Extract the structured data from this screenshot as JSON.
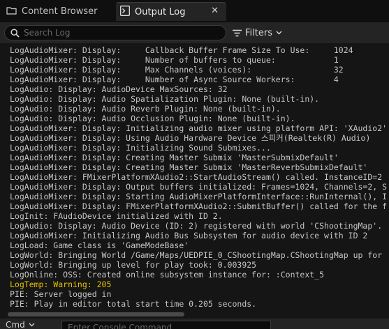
{
  "tabs": {
    "content_browser": {
      "label": "Content Browser",
      "icon": "folder-icon"
    },
    "output_log": {
      "label": "Output Log",
      "icon": "terminal-icon",
      "close_icon": "close-icon"
    }
  },
  "toolbar": {
    "search_placeholder": "Search Log",
    "filters_label": "Filters"
  },
  "log_lines": [
    {
      "text": "LogAudioMixer: Display:     Callback Buffer Frame Size To Use:     1024",
      "level": "info"
    },
    {
      "text": "LogAudioMixer: Display:     Number of buffers to queue:            1",
      "level": "info"
    },
    {
      "text": "LogAudioMixer: Display:     Max Channels (voices):                 32",
      "level": "info"
    },
    {
      "text": "LogAudioMixer: Display:     Number of Async Source Workers:        4",
      "level": "info"
    },
    {
      "text": "LogAudio: Display: AudioDevice MaxSources: 32",
      "level": "info"
    },
    {
      "text": "LogAudio: Display: Audio Spatialization Plugin: None (built-in).",
      "level": "info"
    },
    {
      "text": "LogAudio: Display: Audio Reverb Plugin: None (built-in).",
      "level": "info"
    },
    {
      "text": "LogAudio: Display: Audio Occlusion Plugin: None (built-in).",
      "level": "info"
    },
    {
      "text": "LogAudioMixer: Display: Initializing audio mixer using platform API: 'XAudio2'",
      "level": "info"
    },
    {
      "text": "LogAudioMixer: Display: Using Audio Hardware Device 스피커(Realtek(R) Audio)",
      "level": "info"
    },
    {
      "text": "LogAudioMixer: Display: Initializing Sound Submixes...",
      "level": "info"
    },
    {
      "text": "LogAudioMixer: Display: Creating Master Submix 'MasterSubmixDefault'",
      "level": "info"
    },
    {
      "text": "LogAudioMixer: Display: Creating Master Submix 'MasterReverbSubmixDefault'",
      "level": "info"
    },
    {
      "text": "LogAudioMixer: FMixerPlatformXAudio2::StartAudioStream() called. InstanceID=2",
      "level": "info"
    },
    {
      "text": "LogAudioMixer: Display: Output buffers initialized: Frames=1024, Channels=2, S",
      "level": "info"
    },
    {
      "text": "LogAudioMixer: Display: Starting AudioMixerPlatformInterface::RunInternal(), I",
      "level": "info"
    },
    {
      "text": "LogAudioMixer: Display: FMixerPlatformXAudio2::SubmitBuffer() called for the f",
      "level": "info"
    },
    {
      "text": "LogInit: FAudioDevice initialized with ID 2.",
      "level": "info"
    },
    {
      "text": "LogAudio: Display: Audio Device (ID: 2) registered with world 'CShootingMap'.",
      "level": "info"
    },
    {
      "text": "LogAudioMixer: Initializing Audio Bus Subsystem for audio device with ID 2",
      "level": "info"
    },
    {
      "text": "LogLoad: Game class is 'GameModeBase'",
      "level": "info"
    },
    {
      "text": "LogWorld: Bringing World /Game/Maps/UEDPIE_0_CShootingMap.CShootingMap up for",
      "level": "info"
    },
    {
      "text": "LogWorld: Bringing up level for play took: 0.003925",
      "level": "info"
    },
    {
      "text": "LogOnline: OSS: Created online subsystem instance for: :Context_5",
      "level": "info"
    },
    {
      "text": "LogTemp: Warning: 205",
      "level": "warning"
    },
    {
      "text": "PIE: Server logged in",
      "level": "info"
    },
    {
      "text": "PIE: Play in editor total start time 0.205 seconds.",
      "level": "info"
    }
  ],
  "bottom": {
    "cmd_label": "Cmd",
    "console_placeholder": "Enter Console Command"
  },
  "colors": {
    "log_text": "#c6c6c6",
    "warning": "#e6c200",
    "background": "#151515",
    "panel": "#242424"
  }
}
